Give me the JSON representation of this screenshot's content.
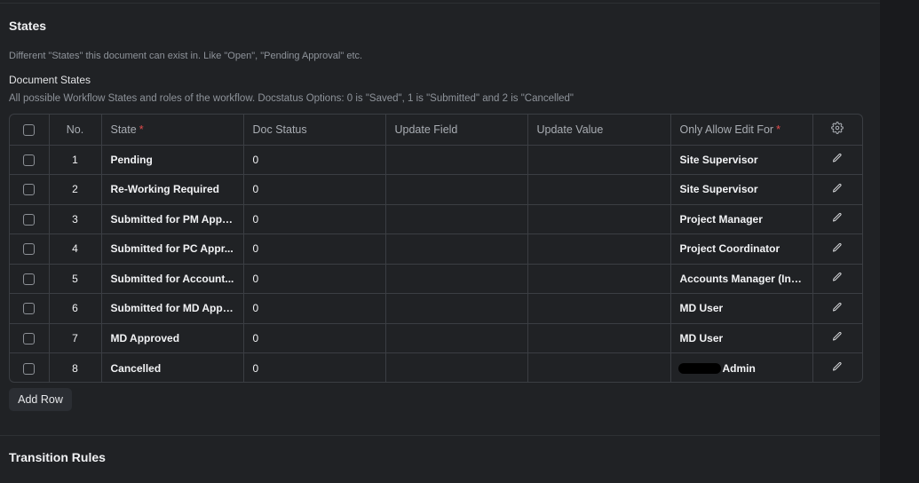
{
  "states_section": {
    "title": "States",
    "description": "Different \"States\" this document can exist in. Like \"Open\", \"Pending Approval\" etc."
  },
  "document_states": {
    "label": "Document States",
    "description": "All possible Workflow States and roles of the workflow. Docstatus Options: 0 is \"Saved\", 1 is \"Submitted\" and 2 is \"Cancelled\"",
    "columns": {
      "no": "No.",
      "state": "State",
      "doc_status": "Doc Status",
      "update_field": "Update Field",
      "update_value": "Update Value",
      "only_allow_edit_for": "Only Allow Edit For",
      "required_marker": "*"
    },
    "header_icon": "gear-icon",
    "row_icon": "edit-icon",
    "rows": [
      {
        "no": "1",
        "state": "Pending",
        "doc_status": "0",
        "update_field": "",
        "update_value": "",
        "allow": "Site Supervisor"
      },
      {
        "no": "2",
        "state": "Re-Working Required",
        "doc_status": "0",
        "update_field": "",
        "update_value": "",
        "allow": "Site Supervisor"
      },
      {
        "no": "3",
        "state": "Submitted for PM Appr...",
        "doc_status": "0",
        "update_field": "",
        "update_value": "",
        "allow": "Project Manager"
      },
      {
        "no": "4",
        "state": "Submitted for PC Appr...",
        "doc_status": "0",
        "update_field": "",
        "update_value": "",
        "allow": "Project Coordinator"
      },
      {
        "no": "5",
        "state": "Submitted for Account...",
        "doc_status": "0",
        "update_field": "",
        "update_value": "",
        "allow": "Accounts Manager (Inv..."
      },
      {
        "no": "6",
        "state": "Submitted for MD Appr...",
        "doc_status": "0",
        "update_field": "",
        "update_value": "",
        "allow": "MD User"
      },
      {
        "no": "7",
        "state": "MD Approved",
        "doc_status": "0",
        "update_field": "",
        "update_value": "",
        "allow": "MD User"
      },
      {
        "no": "8",
        "state": "Cancelled",
        "doc_status": "0",
        "update_field": "",
        "update_value": "",
        "allow": "Admin",
        "allow_redacted_prefix": true
      }
    ],
    "add_row_label": "Add Row"
  },
  "transition_section": {
    "title": "Transition Rules"
  },
  "colors": {
    "background": "#202225",
    "border": "#3b3e43",
    "required": "#e24c4c",
    "button": "#2b2e33"
  }
}
